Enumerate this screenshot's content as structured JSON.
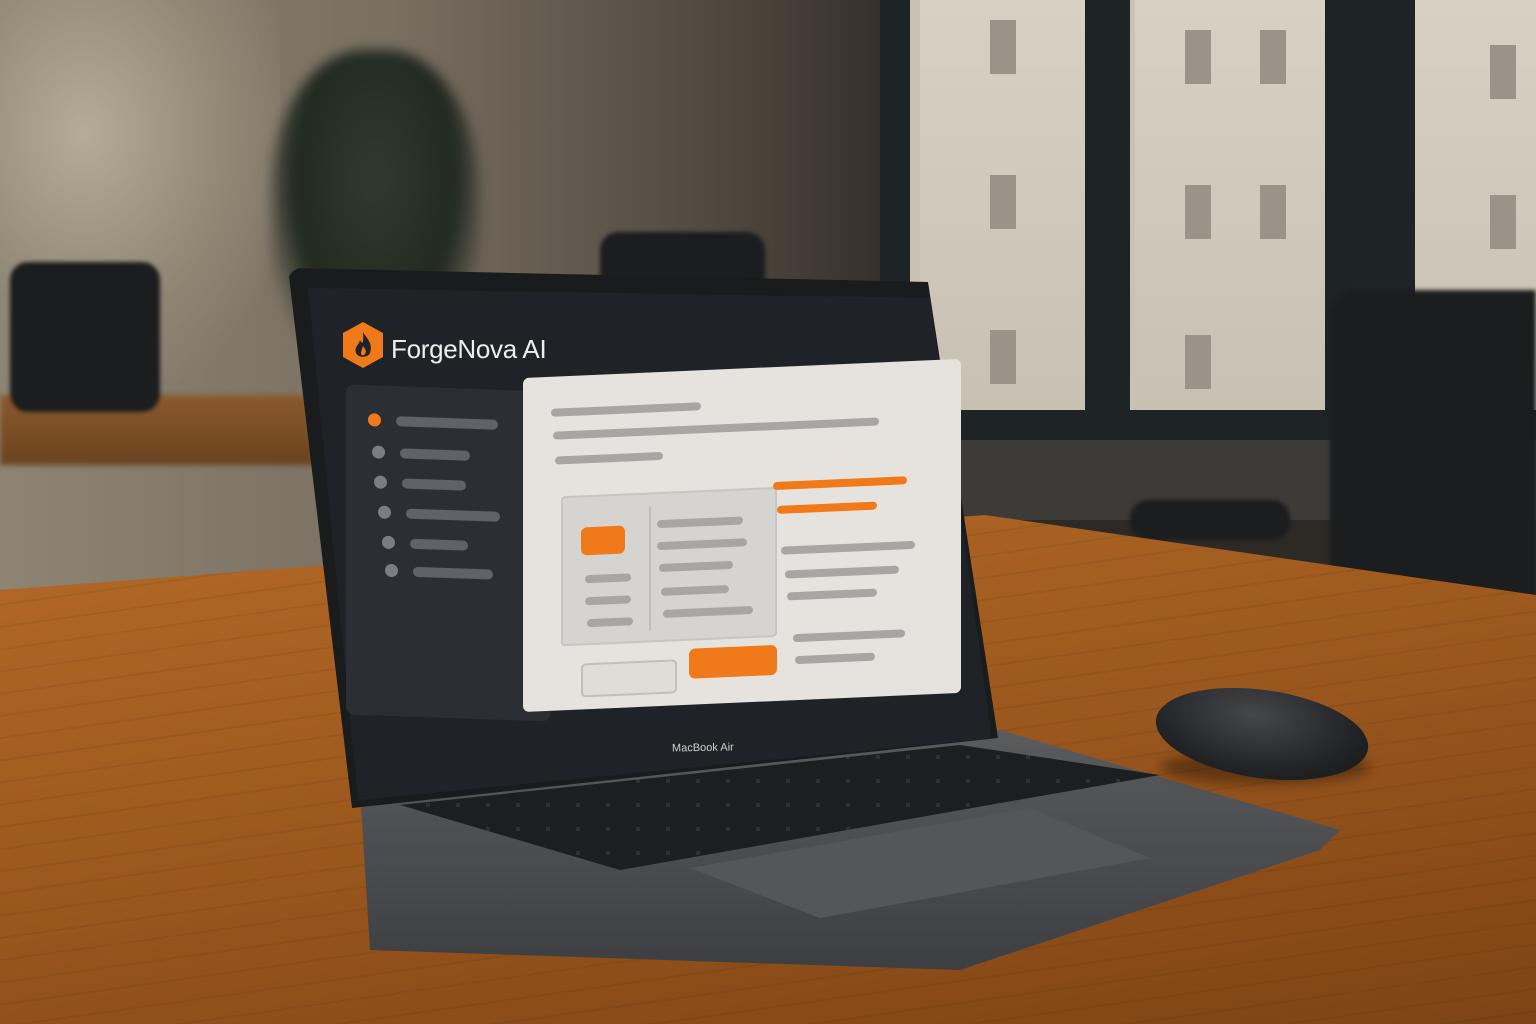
{
  "app": {
    "name": "ForgeNova AI",
    "logo_icon": "flame-hexagon-icon",
    "accent_color": "#f07a1a"
  },
  "laptop": {
    "brand_label": "MacBook Air"
  },
  "sidebar": {
    "active_index": 0,
    "item_count": 6
  },
  "main": {
    "primary_button_color": "#f07a1a"
  }
}
